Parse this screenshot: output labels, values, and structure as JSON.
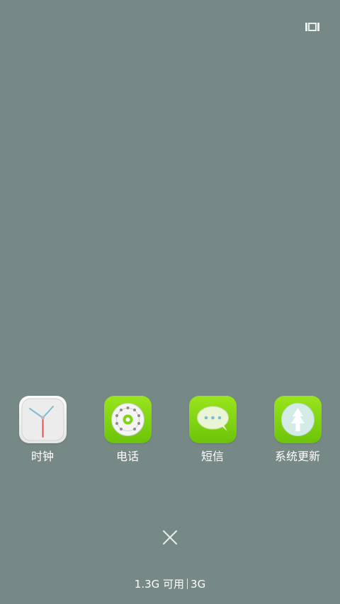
{
  "apps": [
    {
      "label": "时钟",
      "icon": "clock-icon"
    },
    {
      "label": "电话",
      "icon": "phone-dial-icon"
    },
    {
      "label": "短信",
      "icon": "message-bubble-icon"
    },
    {
      "label": "系统更新",
      "icon": "system-update-icon"
    }
  ],
  "top_icon": "multitask-icon",
  "close_icon": "close-icon",
  "storage": {
    "available": "1.3G 可用",
    "network": "3G"
  },
  "colors": {
    "background": "#778986",
    "icon_green": "#7fd413",
    "clock_hand_red": "#e25050"
  }
}
